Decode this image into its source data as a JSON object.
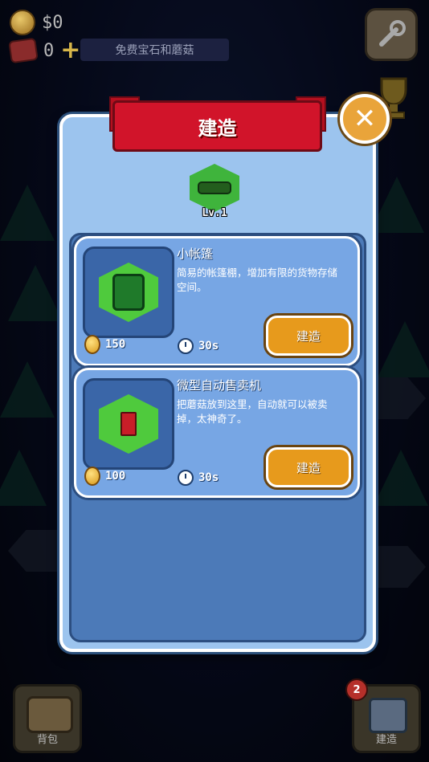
{
  "hud": {
    "money": "$0",
    "gems": "0",
    "add_icon": "plus-icon",
    "free_offer_label": "免费宝石和蘑菇"
  },
  "panel": {
    "title": "建造",
    "close_icon": "close-x-icon",
    "level_label": "Lv.1"
  },
  "items": [
    {
      "title": "小帐篷",
      "description": "简易的帐篷棚，增加有限的货物存储空间。",
      "price": "150",
      "time": "30s",
      "button_label": "建造",
      "thumb_icon": "tent-icon"
    },
    {
      "title": "微型自动售卖机",
      "description": "把蘑菇放到这里，自动就可以被卖掉，太神奇了。",
      "price": "100",
      "time": "30s",
      "button_label": "建造",
      "thumb_icon": "vending-machine-icon"
    }
  ],
  "bottom": {
    "backpack_label": "背包",
    "build_label": "建造",
    "build_badge": "2"
  },
  "colors": {
    "panel_bg": "#9cc4ee",
    "banner_red": "#d1142a",
    "button_orange": "#e79a1c",
    "hex_green": "#4fca3d"
  }
}
